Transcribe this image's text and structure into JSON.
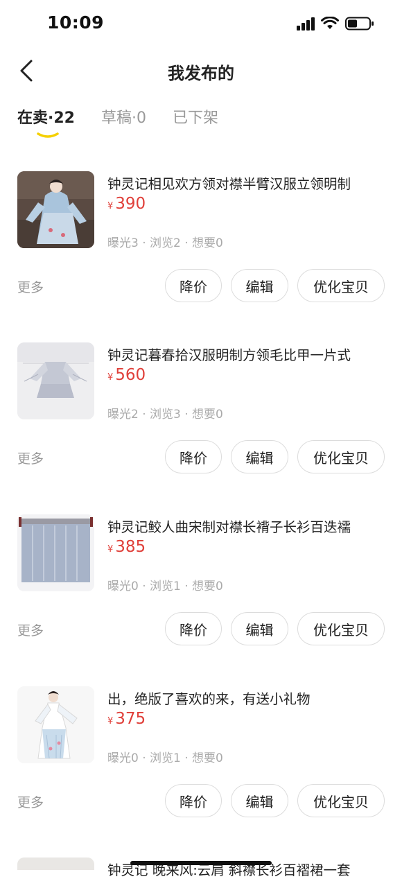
{
  "status_bar": {
    "time": "10:09"
  },
  "nav": {
    "title": "我发布的"
  },
  "tabs": [
    {
      "label": "在卖·22",
      "active": true
    },
    {
      "label": "草稿·0",
      "active": false
    },
    {
      "label": "已下架",
      "active": false
    }
  ],
  "items": [
    {
      "title": "钟灵记相见欢方领对襟半臂汉服立领明制",
      "currency": "¥",
      "price": "390",
      "stats": "曝光3 · 浏览2 · 想要0",
      "more": "更多",
      "btn_price": "降价",
      "btn_edit": "编辑",
      "btn_optimize": "优化宝贝"
    },
    {
      "title": "钟灵记暮春拾汉服明制方领毛比甲一片式",
      "currency": "¥",
      "price": "560",
      "stats": "曝光2 · 浏览3 · 想要0",
      "more": "更多",
      "btn_price": "降价",
      "btn_edit": "编辑",
      "btn_optimize": "优化宝贝"
    },
    {
      "title": "钟灵记鲛人曲宋制对襟长褙子长衫百迭襦",
      "currency": "¥",
      "price": "385",
      "stats": "曝光0 · 浏览1 · 想要0",
      "more": "更多",
      "btn_price": "降价",
      "btn_edit": "编辑",
      "btn_optimize": "优化宝贝"
    },
    {
      "title": "出，绝版了喜欢的来，有送小礼物",
      "currency": "¥",
      "price": "375",
      "stats": "曝光0 · 浏览1 · 想要0",
      "more": "更多",
      "btn_price": "降价",
      "btn_edit": "编辑",
      "btn_optimize": "优化宝贝"
    },
    {
      "title": "钟灵记 晚来风:云肩 斜襟长衫百褶裙一套"
    }
  ],
  "colors": {
    "price": "#e0403a",
    "tab_underline": "#f5d000",
    "muted": "#999999"
  }
}
